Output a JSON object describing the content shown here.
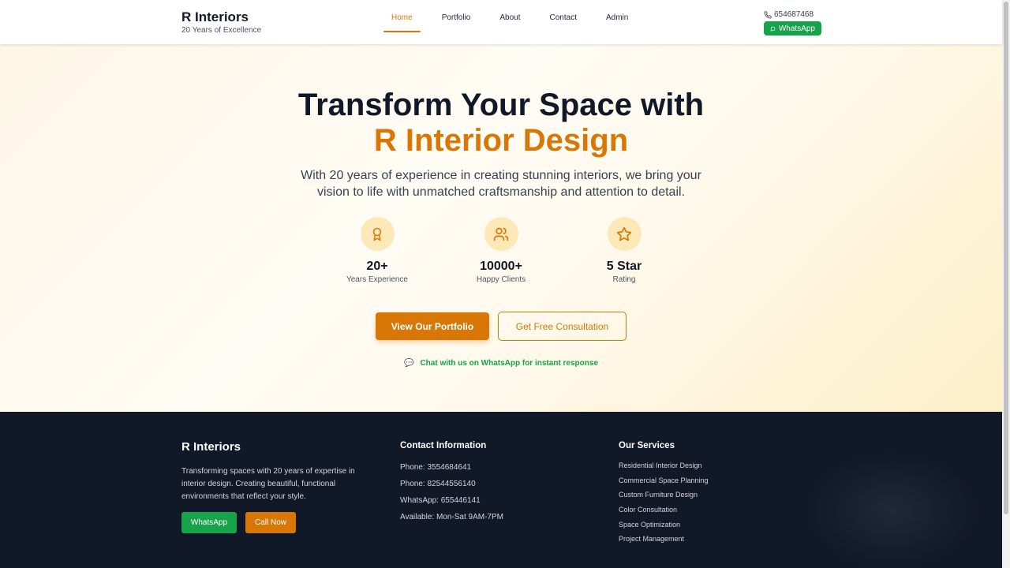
{
  "header": {
    "brand_title": "R Interiors",
    "brand_sub": "20 Years of Excellence",
    "nav": [
      {
        "label": "Home",
        "active": true
      },
      {
        "label": "Portfolio",
        "active": false
      },
      {
        "label": "About",
        "active": false
      },
      {
        "label": "Contact",
        "active": false
      },
      {
        "label": "Admin",
        "active": false
      }
    ],
    "phone": "654687468",
    "whatsapp_label": "WhatsApp",
    "phone_icon": "phone-icon",
    "whatsapp_icon": "message-circle-icon"
  },
  "hero": {
    "title_line1": "Transform Your Space with",
    "title_line2": "R Interior Design",
    "description": "With 20 years of experience in creating stunning interiors, we bring your vision to life with unmatched craftsmanship and attention to detail.",
    "stats": [
      {
        "icon": "award-icon",
        "value": "20+",
        "label": "Years Experience"
      },
      {
        "icon": "users-icon",
        "value": "10000+",
        "label": "Happy Clients"
      },
      {
        "icon": "star-icon",
        "value": "5 Star",
        "label": "Rating"
      }
    ],
    "primary_button": "View Our Portfolio",
    "secondary_button": "Get Free Consultation",
    "chat_emoji": "💬",
    "chat_text": "Chat with us on WhatsApp for instant response"
  },
  "footer": {
    "brand": "R Interiors",
    "description": "Transforming spaces with 20 years of expertise in interior design. Creating beautiful, functional environments that reflect your style.",
    "whatsapp_button": "WhatsApp",
    "call_button": "Call Now",
    "contact_heading": "Contact Information",
    "contacts": [
      "Phone: 3554684641",
      "Phone: 82544556140",
      "WhatsApp: 655446141",
      "Available: Mon-Sat 9AM-7PM"
    ],
    "services_heading": "Our Services",
    "services": [
      "Residential Interior Design",
      "Commercial Space Planning",
      "Custom Furniture Design",
      "Color Consultation",
      "Space Optimization",
      "Project Management"
    ]
  },
  "colors": {
    "accent": "#d97706",
    "whatsapp": "#16a34a",
    "footer_bg": "#111827",
    "text_dark": "#111827"
  }
}
